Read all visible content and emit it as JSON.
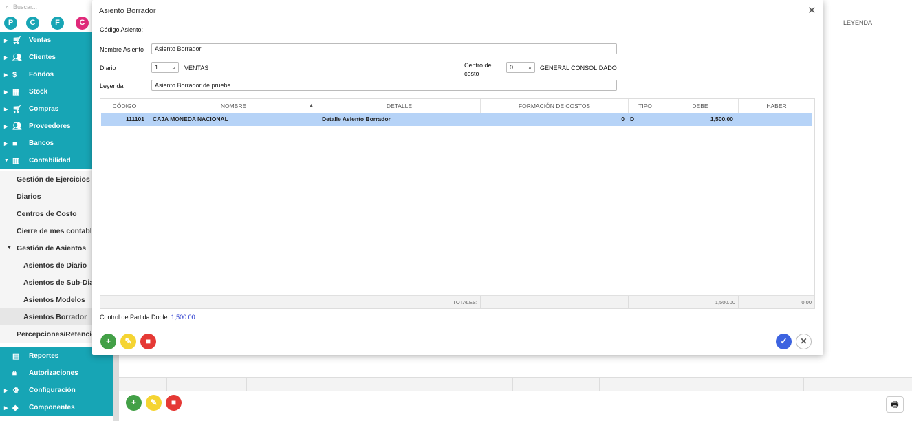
{
  "sidebar": {
    "search_placeholder": "Buscar...",
    "avatars": [
      "P",
      "C",
      "F",
      "C"
    ],
    "avatar_colors": [
      "#17a5b5",
      "#17a5b5",
      "#17a5b5",
      "#e0297a"
    ],
    "menu": [
      {
        "label": "Ventas",
        "icon": "cart-icon"
      },
      {
        "label": "Clientes",
        "icon": "users-icon"
      },
      {
        "label": "Fondos",
        "icon": "dollar-icon"
      },
      {
        "label": "Stock",
        "icon": "box-icon"
      },
      {
        "label": "Compras",
        "icon": "cart-icon"
      },
      {
        "label": "Proveedores",
        "icon": "users-icon"
      },
      {
        "label": "Bancos",
        "icon": "briefcase-icon"
      },
      {
        "label": "Contabilidad",
        "icon": "book-icon"
      }
    ],
    "contabilidad_items": [
      "Gestión de Ejercicios",
      "Diarios",
      "Centros de Costo",
      "Cierre de mes contable"
    ],
    "gestion_asientos_label": "Gestión de Asientos",
    "asientos_items": [
      "Asientos de Diario",
      "Asientos de Sub-Diario",
      "Asientos Modelos",
      "Asientos Borrador"
    ],
    "percepciones_label": "Percepciones/Retenciones",
    "bottom_menu": [
      {
        "label": "Reportes",
        "icon": "file-icon"
      },
      {
        "label": "Autorizaciones",
        "icon": "lock-icon"
      },
      {
        "label": "Configuración",
        "icon": "gears-icon"
      },
      {
        "label": "Componentes",
        "icon": "tag-icon"
      }
    ]
  },
  "background": {
    "leyenda_header": "LEYENDA"
  },
  "modal": {
    "title": "Asiento Borrador",
    "codigo_label": "Código Asiento:",
    "nombre_label": "Nombre Asiento",
    "nombre_value": "Asiento Borrador",
    "diario_label": "Diario",
    "diario_code": "1",
    "diario_name": "VENTAS",
    "centro_label_1": "Centro de",
    "centro_label_2": "costo",
    "centro_code": "0",
    "centro_name": "GENERAL CONSOLIDADO",
    "leyenda_label": "Leyenda",
    "leyenda_value": "Asiento Borrador de prueba",
    "table": {
      "headers": [
        "CÓDIGO",
        "NOMBRE",
        "DETALLE",
        "FORMACIÓN DE COSTOS",
        "TIPO",
        "DEBE",
        "HABER"
      ],
      "rows": [
        {
          "codigo": "111101",
          "nombre": "CAJA MONEDA NACIONAL",
          "detalle": "Detalle Asiento Borrador",
          "formacion": "0",
          "tipo": "D",
          "debe": "1,500.00",
          "haber": ""
        }
      ],
      "totales_label": "TOTALES:",
      "total_debe": "1,500.00",
      "total_haber": "0.00"
    },
    "control_label": "Control de Partida Doble:",
    "control_value": "1,500.00"
  }
}
